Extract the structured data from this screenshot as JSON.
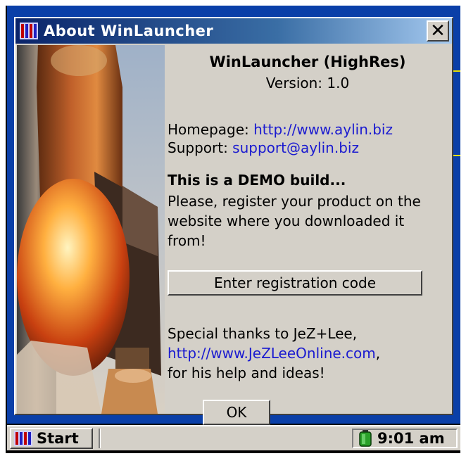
{
  "window": {
    "title": "About WinLauncher",
    "close_glyph": "✕"
  },
  "about": {
    "product": "WinLauncher (HighRes)",
    "version": "Version: 1.0",
    "homepage_label": "Homepage:",
    "homepage_url": "http://www.aylin.biz",
    "support_label": "Support:",
    "support_email": "support@aylin.biz",
    "demo_title": "This is a DEMO build...",
    "demo_text": "Please, register your product on the website where you downloaded it from!",
    "register_button": "Enter registration code",
    "thanks_line1": "Special thanks to JeZ+Lee,",
    "thanks_url": "http://www.JeZLeeOnline.com",
    "thanks_line3": "for his help and ideas!",
    "ok_button": "OK"
  },
  "taskbar": {
    "start_label": "Start",
    "clock": "9:01 am"
  },
  "icons": {
    "app": "winlauncher-icon",
    "close": "close-icon",
    "start": "start-logo-icon",
    "tray": "battery-status-icon"
  },
  "colors": {
    "title_gradient_start": "#0a246a",
    "link": "#1a1ad0",
    "face": "#d4d0c8"
  }
}
